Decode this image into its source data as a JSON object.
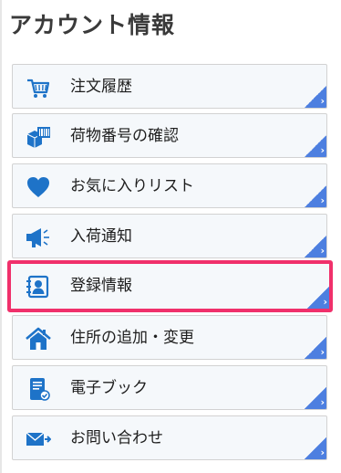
{
  "header": {
    "title": "アカウント情報"
  },
  "menu": {
    "items": [
      {
        "label": "注文履歴",
        "icon": "shopping-cart-icon"
      },
      {
        "label": "荷物番号の確認",
        "icon": "package-barcode-icon"
      },
      {
        "label": "お気に入りリスト",
        "icon": "heart-icon"
      },
      {
        "label": "入荷通知",
        "icon": "megaphone-icon"
      },
      {
        "label": "登録情報",
        "icon": "contact-card-icon",
        "selected": true
      },
      {
        "label": "住所の追加・変更",
        "icon": "house-icon"
      },
      {
        "label": "電子ブック",
        "icon": "ebook-icon"
      },
      {
        "label": "お問い合わせ",
        "icon": "mail-send-icon"
      }
    ],
    "corner_arrow": "›"
  },
  "colors": {
    "accent": "#1e73c8",
    "selected_border": "#f0306b",
    "corner": "#4d7fe0",
    "item_bg": "#f5f8fb"
  }
}
